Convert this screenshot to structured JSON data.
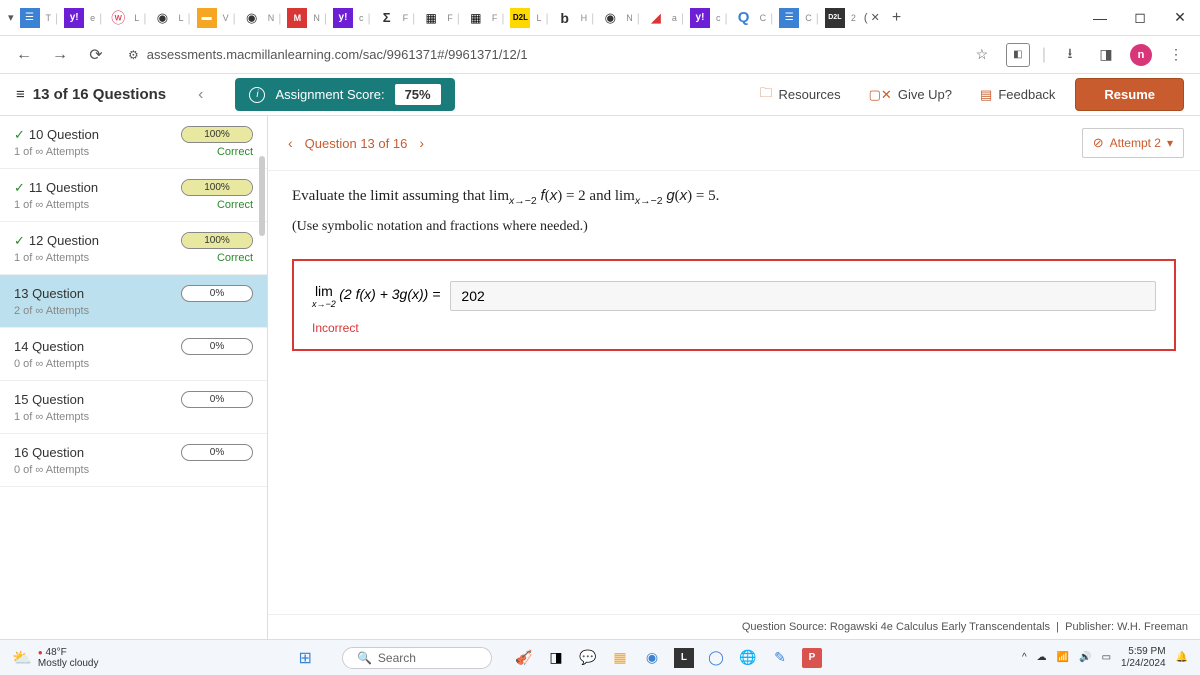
{
  "browser": {
    "url": "assessments.macmillanlearning.com/sac/9961371#/9961371/12/1"
  },
  "appbar": {
    "question_counter": "13 of 16 Questions",
    "score_label": "Assignment Score:",
    "score_value": "75%",
    "resources": "Resources",
    "giveup": "Give Up?",
    "feedback": "Feedback",
    "resume": "Resume"
  },
  "sidebar": {
    "items": [
      {
        "label": "10 Question",
        "percent": "100%",
        "attempts": "1 of ∞ Attempts",
        "status": "Correct",
        "correct": true,
        "fill": 100
      },
      {
        "label": "11 Question",
        "percent": "100%",
        "attempts": "1 of ∞ Attempts",
        "status": "Correct",
        "correct": true,
        "fill": 100
      },
      {
        "label": "12 Question",
        "percent": "100%",
        "attempts": "1 of ∞ Attempts",
        "status": "Correct",
        "correct": true,
        "fill": 100
      },
      {
        "label": "13 Question",
        "percent": "0%",
        "attempts": "2 of ∞ Attempts",
        "status": "",
        "correct": false,
        "fill": 0,
        "active": true
      },
      {
        "label": "14 Question",
        "percent": "0%",
        "attempts": "0 of ∞ Attempts",
        "status": "",
        "correct": false,
        "fill": 0
      },
      {
        "label": "15 Question",
        "percent": "0%",
        "attempts": "1 of ∞ Attempts",
        "status": "",
        "correct": false,
        "fill": 0
      },
      {
        "label": "16 Question",
        "percent": "0%",
        "attempts": "0 of ∞ Attempts",
        "status": "",
        "correct": false,
        "fill": 0
      }
    ]
  },
  "main": {
    "nav_label": "Question 13 of 16",
    "attempt_label": "Attempt 2",
    "question_html": "Evaluate the limit assuming that lim<sub><i>x</i>→−2</sub> <i>f</i>(<i>x</i>) = 2 and lim<sub><i>x</i>→−2</sub> <i>g</i>(<i>x</i>) = 5.",
    "hint": "(Use symbolic notation and fractions where needed.)",
    "answer": {
      "lim_top": "lim",
      "lim_bottom": "x→−2",
      "expr": "(2 f(x) + 3g(x)) =",
      "value": "202"
    },
    "incorrect": "Incorrect",
    "source": "Question Source: Rogawski 4e Calculus Early Transcendentals",
    "publisher": "Publisher: W.H. Freeman"
  },
  "taskbar": {
    "temp": "48°F",
    "cond": "Mostly cloudy",
    "search_placeholder": "Search",
    "time": "5:59 PM",
    "date": "1/24/2024"
  }
}
